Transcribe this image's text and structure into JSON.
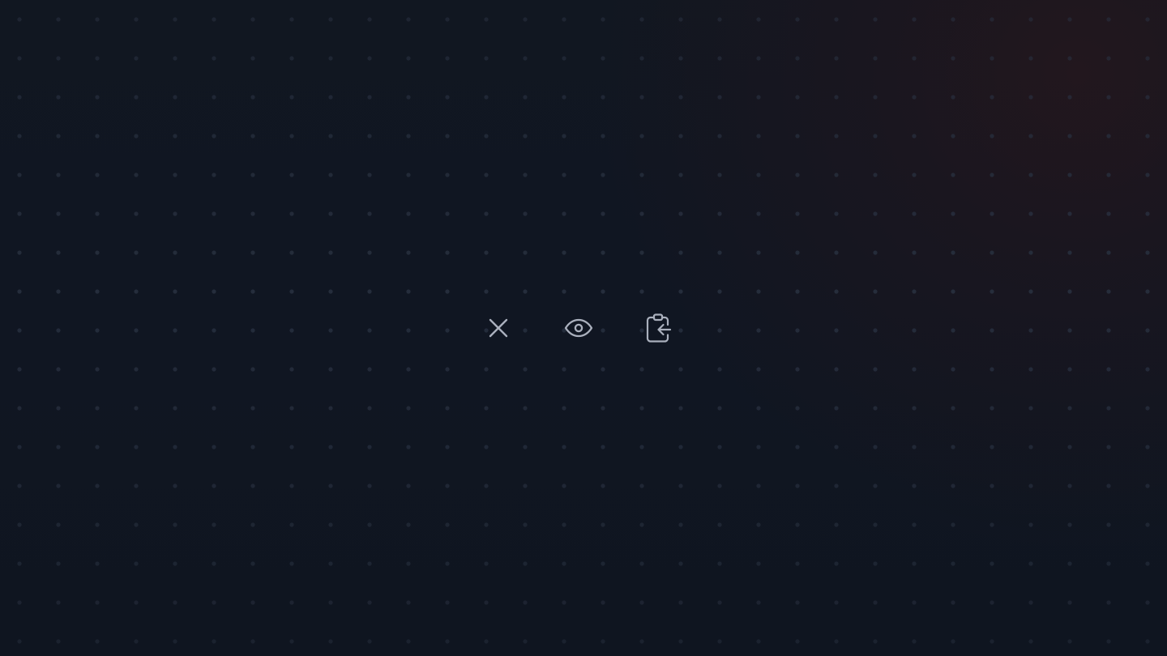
{
  "theme": {
    "background": "#0f1520",
    "dot_color": "#293140",
    "icon_color": "#aab0bd",
    "warm_glow": "#431718"
  },
  "toolbar": {
    "items": [
      {
        "icon": "close-icon"
      },
      {
        "icon": "eye-icon"
      },
      {
        "icon": "clipboard-return-icon"
      }
    ]
  }
}
